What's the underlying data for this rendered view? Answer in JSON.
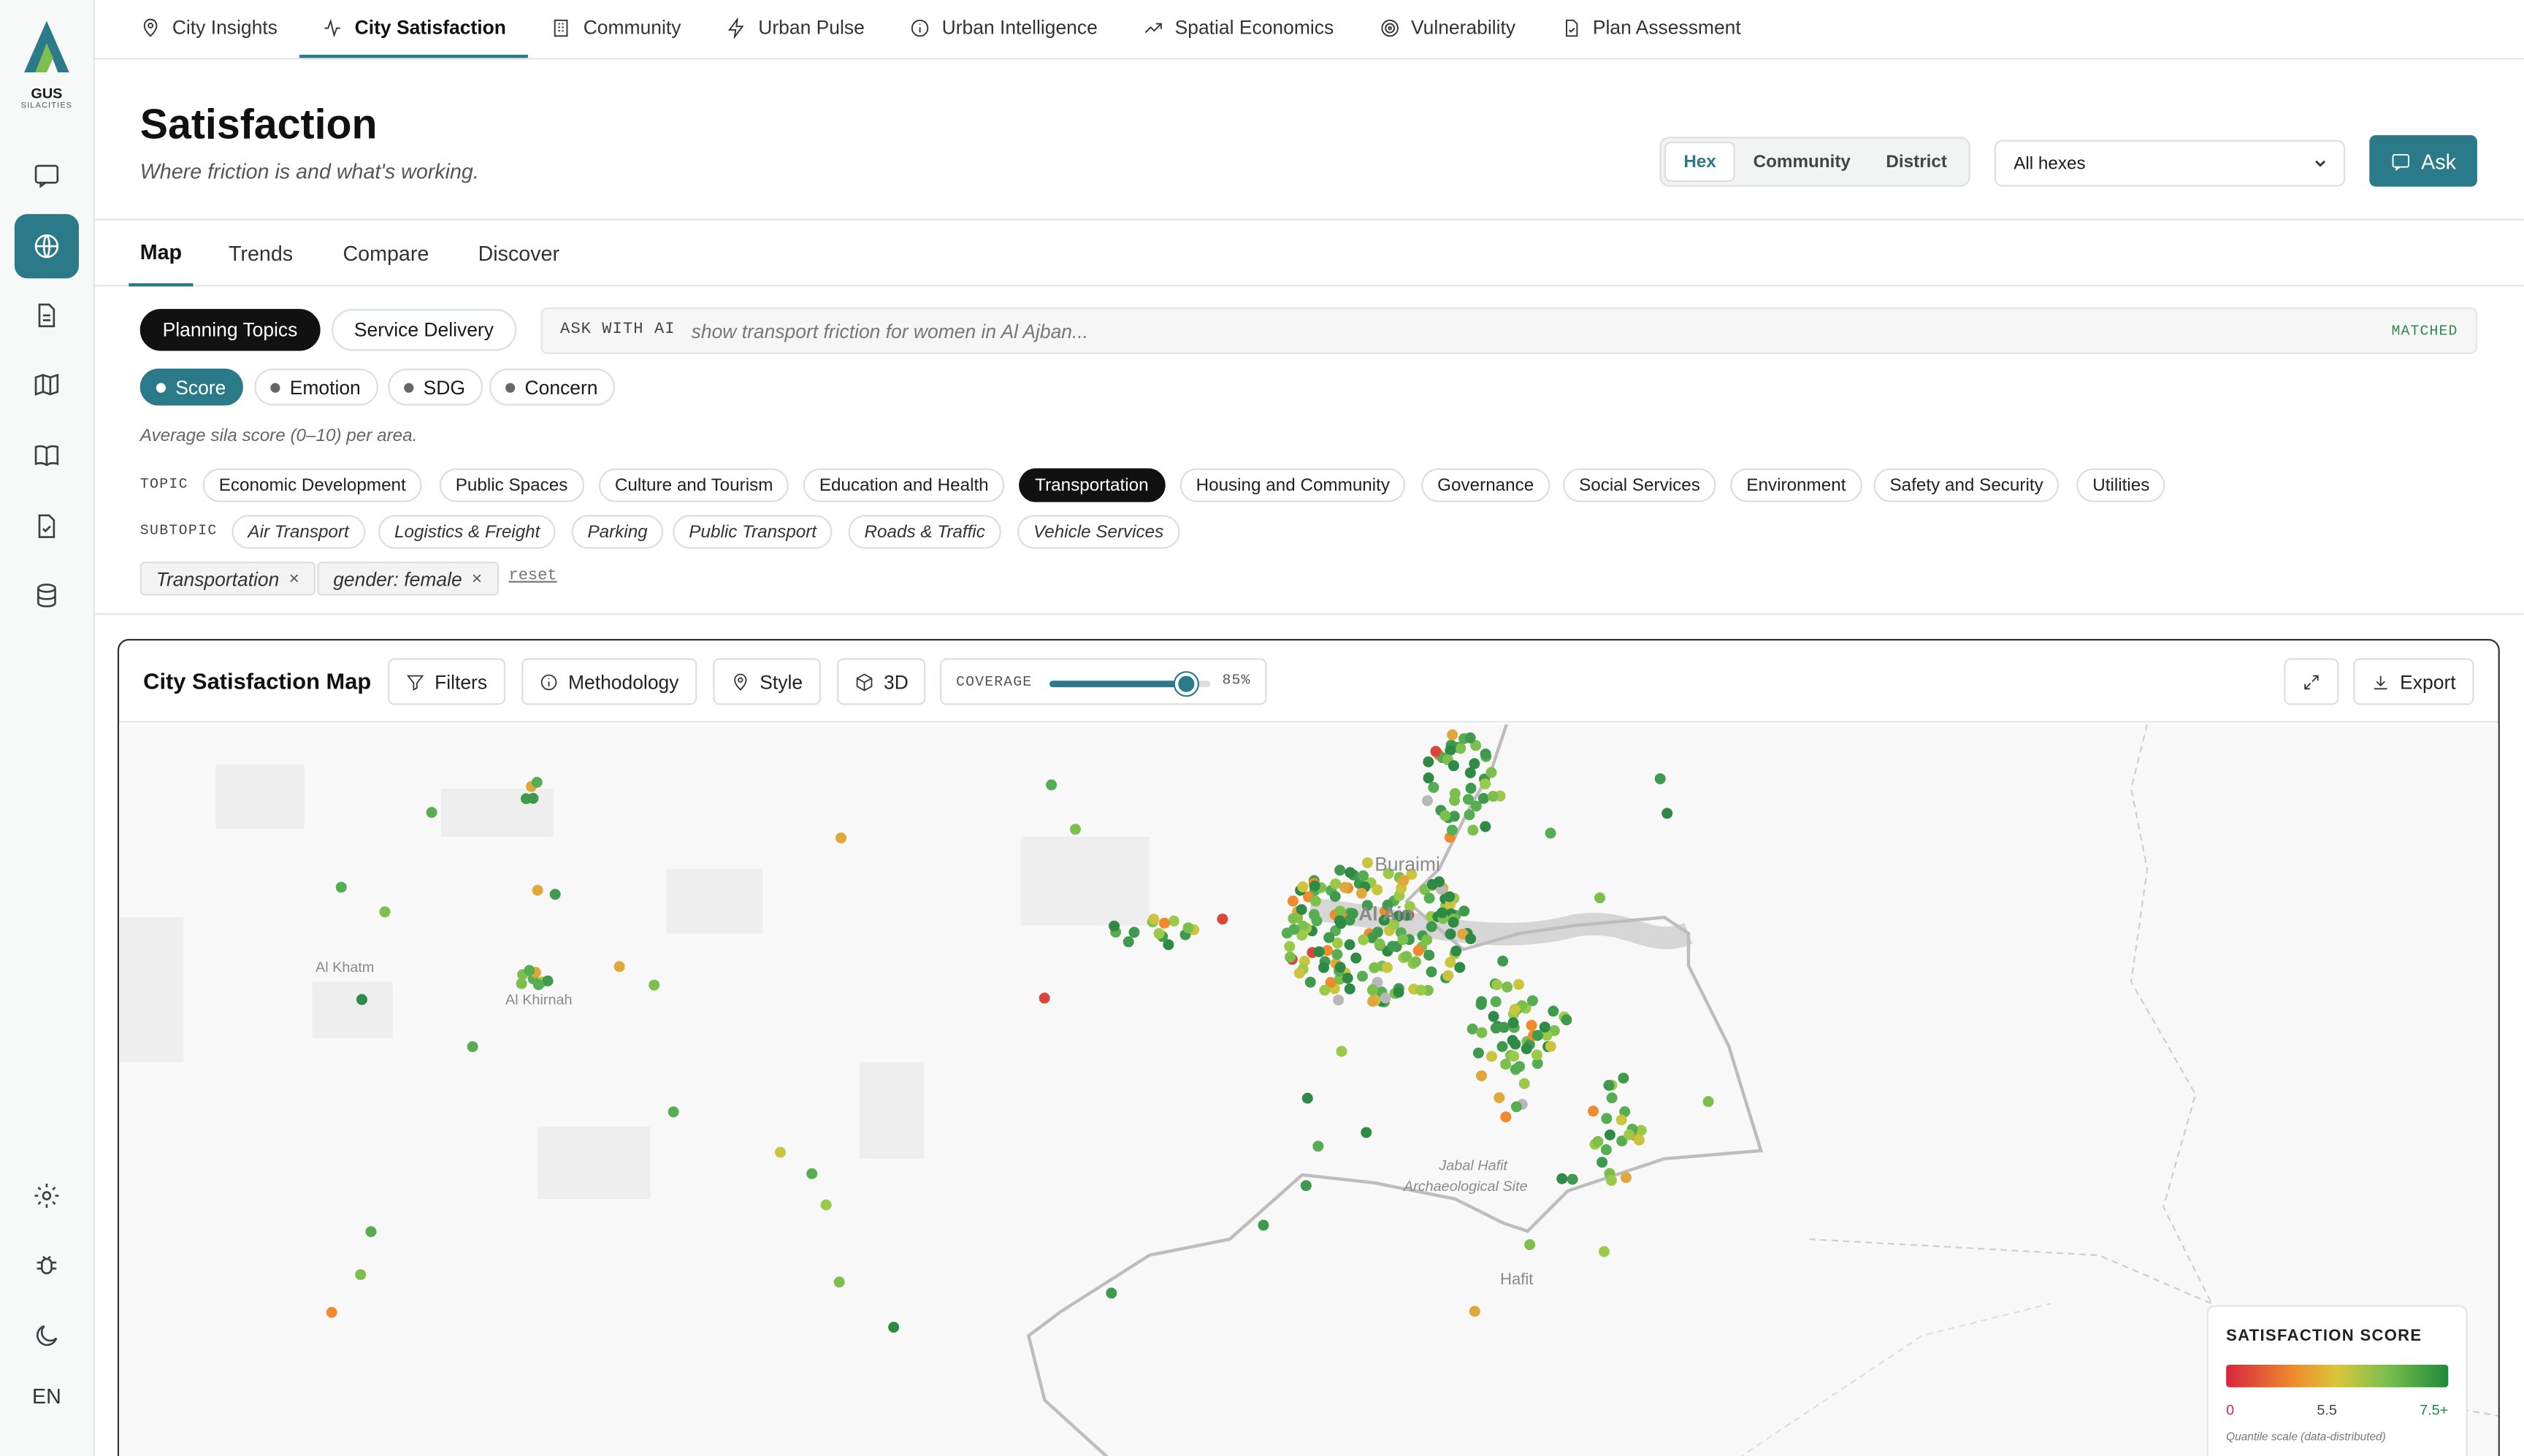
{
  "brand": {
    "name": "GUS",
    "sub": "SILACITIES"
  },
  "topnav": [
    "City Insights",
    "City Satisfaction",
    "Community",
    "Urban Pulse",
    "Urban Intelligence",
    "Spatial Economics",
    "Vulnerability",
    "Plan Assessment"
  ],
  "header": {
    "title": "Satisfaction",
    "subtitle": "Where friction is and what's working."
  },
  "granularity": {
    "options": [
      "Hex",
      "Community",
      "District"
    ],
    "selected": "Hex"
  },
  "area_select": {
    "value": "All hexes"
  },
  "ask_label": "Ask",
  "tabs": [
    "Map",
    "Trends",
    "Compare",
    "Discover"
  ],
  "modes": [
    "Planning Topics",
    "Service Delivery"
  ],
  "ai": {
    "label": "ASK WITH AI",
    "query": "show transport friction for women in Al Ajban...",
    "status": "MATCHED"
  },
  "metrics": [
    "Score",
    "Emotion",
    "SDG",
    "Concern"
  ],
  "metric_note": "Average sila score (0–10) per area.",
  "topic": {
    "label": "TOPIC",
    "items": [
      "Economic Development",
      "Public Spaces",
      "Culture and Tourism",
      "Education and Health",
      "Transportation",
      "Housing and Community",
      "Governance",
      "Social Services",
      "Environment",
      "Safety and Security",
      "Utilities"
    ]
  },
  "subtopic": {
    "label": "SUBTOPIC",
    "items": [
      "Air Transport",
      "Logistics & Freight",
      "Parking",
      "Public Transport",
      "Roads & Traffic",
      "Vehicle Services"
    ]
  },
  "active_filters": [
    "Transportation",
    "gender: female"
  ],
  "reset_label": "reset",
  "map_card": {
    "title": "City Satisfaction Map",
    "buttons": [
      "Filters",
      "Methodology",
      "Style",
      "3D"
    ],
    "coverage_label": "COVERAGE",
    "coverage_pct": 85,
    "coverage_text": "85%",
    "export_label": "Export"
  },
  "places": [
    "Buraimi",
    "Al Ain",
    "Al Khatm",
    "Al Khirnah",
    "Jabal Hafit",
    "Archaeological Site",
    "Hafit"
  ],
  "legend": {
    "title": "SATISFACTION SCORE",
    "min": "0",
    "mid": "5.5",
    "max": "7.5+",
    "note": "Quantile scale (data-distributed)"
  },
  "sidebar_lang": "EN",
  "colors": {
    "accent": "#2b7a8a",
    "low": "#d7263d",
    "mid": "#d9c63a",
    "high": "#1f8a3c"
  }
}
